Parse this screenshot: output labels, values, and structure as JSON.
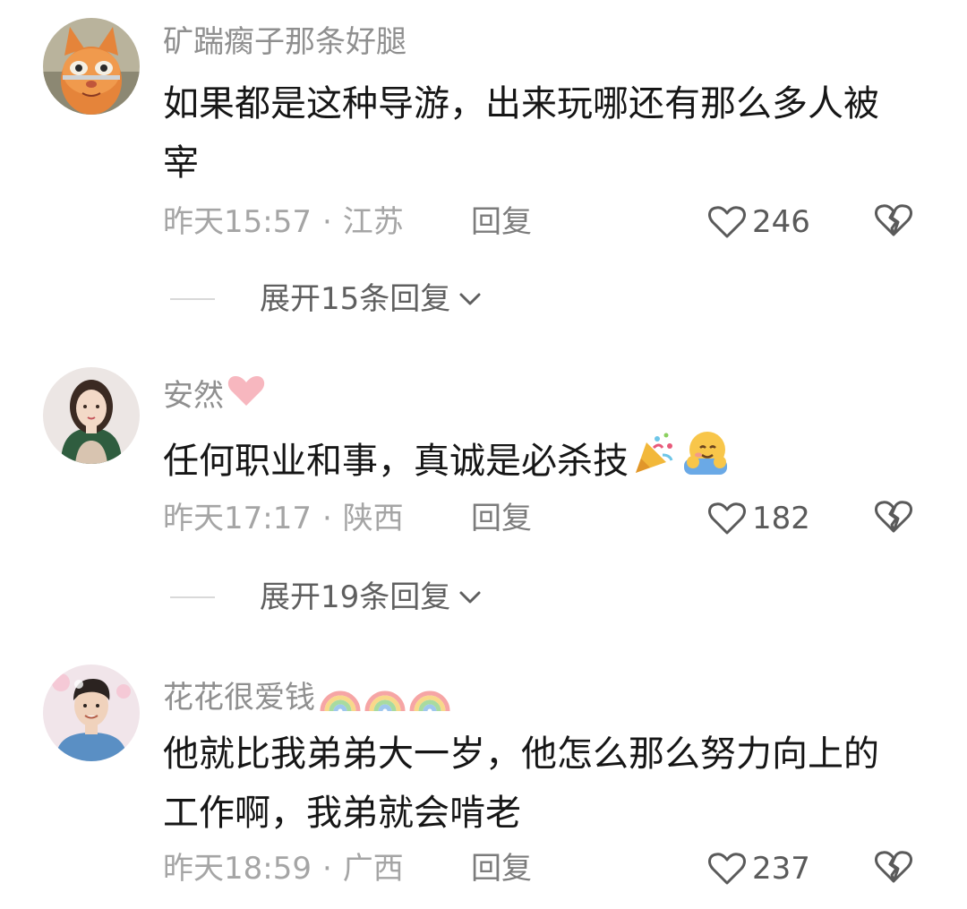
{
  "comments": [
    {
      "username": "矿踹瘸子那条好腿",
      "text": "如果都是这种导游，出来玩哪还有那么多人被宰",
      "time": "昨天15:57",
      "separator": "·",
      "location": "江苏",
      "reply_label": "回复",
      "likes": "246",
      "expand_label": "展开15条回复",
      "avatar_icon": "orange-cat-avatar",
      "username_deco": ""
    },
    {
      "username": "安然",
      "text": "任何职业和事，真诚是必杀技",
      "time": "昨天17:17",
      "separator": "·",
      "location": "陕西",
      "reply_label": "回复",
      "likes": "182",
      "expand_label": "展开19条回复",
      "avatar_icon": "woman-portrait-avatar",
      "username_deco": "pink-heart-icon",
      "text_emojis": [
        "party-popper-icon",
        "hugging-face-icon"
      ]
    },
    {
      "username": "花花很爱钱",
      "text": "他就比我弟弟大一岁，他怎么那么努力向上的工作啊，我弟就会啃老",
      "time": "昨天18:59",
      "separator": "·",
      "location": "广西",
      "reply_label": "回复",
      "likes": "237",
      "avatar_icon": "young-man-portrait-avatar",
      "username_deco": "rainbow-icon x3"
    }
  ],
  "colors": {
    "text": "#161616",
    "username": "#8f8f8f",
    "meta": "#a5a5a5",
    "reply": "#7c7c7c",
    "expand": "#5f5f5f",
    "heart_deco": "#f7b7bf"
  }
}
